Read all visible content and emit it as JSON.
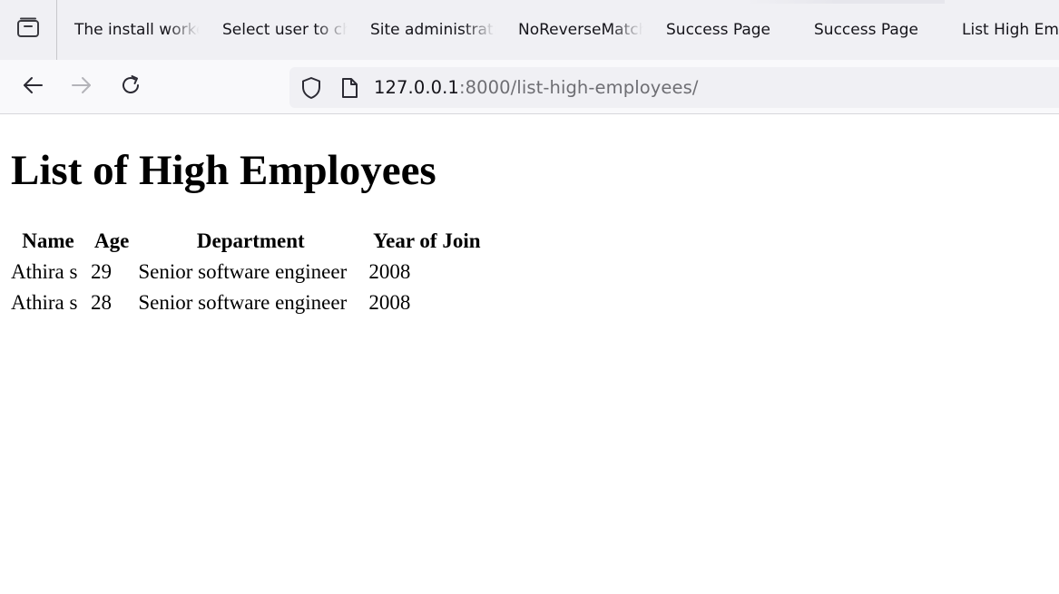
{
  "browser": {
    "tabs": [
      {
        "title": "The install worked successfully! Congratulations!"
      },
      {
        "title": "Select user to change"
      },
      {
        "title": "Site administration"
      },
      {
        "title": "NoReverseMatch"
      },
      {
        "title": "Success Page"
      },
      {
        "title": "Success Page"
      },
      {
        "title": "List High Employees"
      }
    ],
    "url": {
      "host": "127.0.0.1",
      "rest": ":8000/list-high-employees/"
    }
  },
  "page": {
    "heading": "List of High Employees",
    "table": {
      "headers": [
        "Name",
        "Age",
        "Department",
        "Year of Join"
      ],
      "rows": [
        [
          "Athira s",
          "29",
          "Senior software engineer",
          "2008"
        ],
        [
          "Athira s",
          "28",
          "Senior software engineer",
          "2008"
        ]
      ]
    }
  },
  "icons": {
    "tab_manager": "tab-manager-icon",
    "back": "back-arrow-icon",
    "forward": "forward-arrow-icon",
    "reload": "reload-icon",
    "shield": "shield-icon",
    "page": "page-icon"
  }
}
